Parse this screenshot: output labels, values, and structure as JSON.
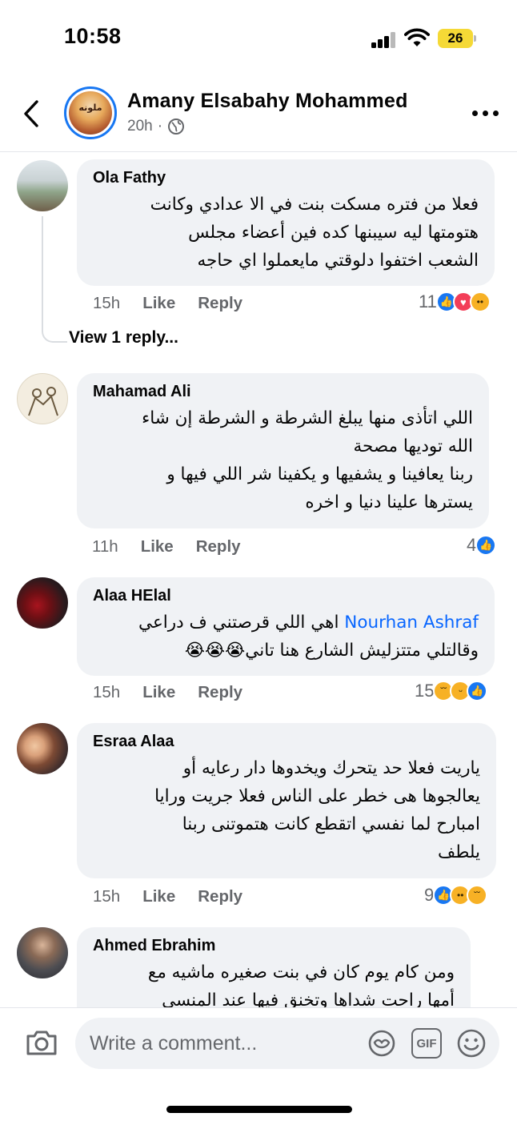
{
  "status_bar": {
    "time": "10:58",
    "battery": "26"
  },
  "header": {
    "page_name": "Amany Elsabahy Mohammed",
    "time": "20h",
    "dot": "·",
    "avatar_text": "ملونه"
  },
  "comments": [
    {
      "name": "Ola Fathy",
      "lines": [
        "فعلا من فتره مسكت بنت في الا عدادي وكانت",
        "هتومتها ليه سيبنها كده فين أعضاء مجلس",
        "الشعب اختفوا دلوقتي مايعملوا اي حاجه"
      ],
      "time": "15h",
      "like": "Like",
      "reply": "Reply",
      "reaction_count": "11",
      "reactions": [
        "like-icon",
        "love-icon",
        "wow-icon"
      ]
    },
    {
      "name": "Mahamad Ali",
      "lines": [
        "اللي اتأذى منها يبلغ الشرطة و الشرطة إن شاء",
        "الله توديها مصحة",
        "ربنا يعافينا و يشفيها و يكفينا شر اللي فيها و",
        "يسترها علينا دنيا و اخره"
      ],
      "time": "11h",
      "like": "Like",
      "reply": "Reply",
      "reaction_count": "4",
      "reactions": [
        "like-icon"
      ]
    },
    {
      "name": "Alaa HElal",
      "mention": "Nourhan Ashraf",
      "lines": [
        "اهي اللي قرصتني ف دراعي",
        "وقالتلي متتزليش الشارع هنا تاني😭😭😭"
      ],
      "time": "15h",
      "like": "Like",
      "reply": "Reply",
      "reaction_count": "15",
      "reactions": [
        "sad-icon",
        "haha-icon",
        "like-icon"
      ]
    },
    {
      "name": "Esraa Alaa",
      "lines": [
        "ياريت فعلا حد يتحرك ويخدوها دار رعايه أو",
        "يعالجوها هى خطر على الناس فعلا جريت ورايا",
        "امبارح لما نفسي اتقطع كانت هتموتنى ربنا",
        "يلطف"
      ],
      "time": "15h",
      "like": "Like",
      "reply": "Reply",
      "reaction_count": "9",
      "reactions": [
        "like-icon",
        "wow-icon",
        "sad-icon"
      ]
    },
    {
      "name": "Ahmed Ebrahim",
      "lines": [
        "ومن كام يوم كان في بنت صغيره ماشيه مع",
        "أمها راحت شداها وتخنق فيها عند المنسي"
      ]
    }
  ],
  "view_replies": "View 1 reply...",
  "composer": {
    "placeholder": "Write a comment...",
    "gif_label": "GIF"
  },
  "colors": {
    "accent": "#1877f2",
    "bubble": "#f0f2f5",
    "meta": "#65676b",
    "mention": "#0866ff"
  }
}
